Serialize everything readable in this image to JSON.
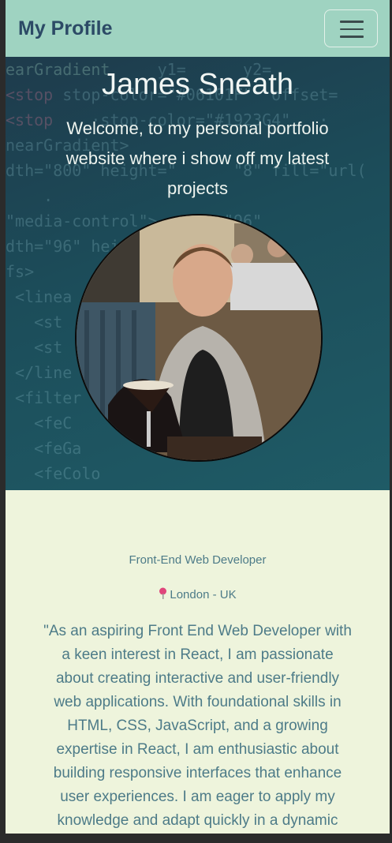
{
  "navbar": {
    "brand": "My Profile",
    "toggle_icon": "hamburger-menu-icon"
  },
  "hero": {
    "name": "James Sneath",
    "welcome": "Welcome, to my personal portfolio website where i show off my latest projects",
    "avatar_alt": "Profile photo"
  },
  "about": {
    "role": "Front-End Web Developer",
    "location_icon": "map-pin-icon",
    "location": "London - UK",
    "bio": "\"As an aspiring Front End Web Developer with a keen interest in React, I am passionate about creating interactive and user-friendly web applications. With foundational skills in HTML, CSS, JavaScript, and a growing expertise in React, I am enthusiastic about building responsive interfaces that enhance user experiences. I am eager to apply my knowledge and adapt quickly in a dynamic"
  },
  "colors": {
    "navbar_bg": "#9fd3c1",
    "brand": "#2c4a66",
    "body_bg": "#eef4dc",
    "text_accent": "#4d7b88",
    "pin": "#e0457b"
  }
}
